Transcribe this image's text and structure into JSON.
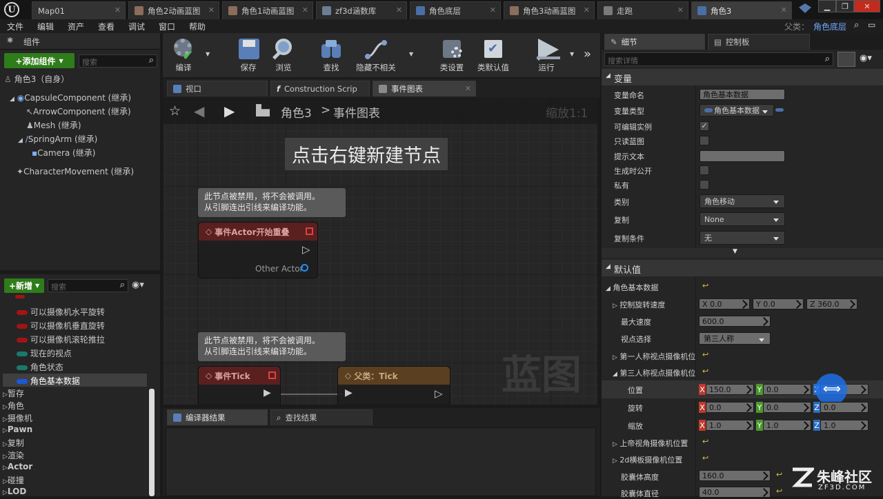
{
  "window": {
    "tabs": [
      {
        "label": "Map01"
      },
      {
        "label": "角色2动画蓝图"
      },
      {
        "label": "角色1动画蓝图"
      },
      {
        "label": "zf3d涵数库"
      },
      {
        "label": "角色底层"
      },
      {
        "label": "角色3动画蓝图"
      },
      {
        "label": "走跑"
      },
      {
        "label": "角色3"
      }
    ],
    "parent_label": "父类：",
    "parent_value": "角色底层"
  },
  "menu": [
    "文件",
    "编辑",
    "资产",
    "查看",
    "调试",
    "窗口",
    "帮助"
  ],
  "components": {
    "title": "组件",
    "add_button": "+添加组件",
    "search_placeholder": "搜索",
    "self": "角色3（自身）",
    "items": [
      "CapsuleComponent (继承)",
      "ArrowComponent (继承)",
      "Mesh (继承)",
      "SpringArm (继承)",
      "Camera (继承)",
      "CharacterMovement (继承)"
    ]
  },
  "mybp": {
    "add_button": "+新增",
    "search_placeholder": "搜索",
    "vars": [
      {
        "name": "可以摄像机水平旋转",
        "color": "#a31414"
      },
      {
        "name": "可以摄像机垂直旋转",
        "color": "#a31414"
      },
      {
        "name": "可以摄像机滚轮推拉",
        "color": "#a31414"
      },
      {
        "name": "现在的视点",
        "color": "#1a7a6a"
      },
      {
        "name": "角色状态",
        "color": "#1a7a6a"
      },
      {
        "name": "角色基本数据",
        "color": "#1a5ad9"
      }
    ],
    "cats": [
      "暂存",
      "角色",
      "摄像机",
      "Pawn",
      "复制",
      "渲染",
      "Actor",
      "碰撞",
      "LOD"
    ]
  },
  "toolbar": [
    "编译",
    "保存",
    "浏览",
    "查找",
    "隐藏不相关",
    "类设置",
    "类默认值",
    "运行"
  ],
  "graph": {
    "tabs": [
      "视口",
      "Construction Scrip",
      "事件图表"
    ],
    "crumb_root": "角色3",
    "crumb_sep": ">",
    "crumb_leaf": "事件图表",
    "zoom": "缩放1:1",
    "hint": "点击右键新建节点",
    "watermark": "蓝图",
    "comment1": [
      "此节点被禁用，将不会被调用。",
      "从引脚连出引线来编译功能。"
    ],
    "comment2": [
      "此节点被禁用，将不会被调用。",
      "从引脚连出引线来编译功能。"
    ],
    "node1_title": "事件Actor开始重叠",
    "node1_pin": "Other Actor",
    "node2_title": "事件Tick",
    "node3_title": "父类：Tick"
  },
  "bottom_tabs": [
    "编译器结果",
    "查找结果"
  ],
  "details": {
    "tab1": "细节",
    "tab2": "控制板",
    "search_placeholder": "搜索详情",
    "sect_var": "变量",
    "sect_default": "默认值",
    "var_rows": [
      {
        "label": "变量命名",
        "value": "角色基本数据"
      },
      {
        "label": "变量类型",
        "value": "角色基本数据"
      },
      {
        "label": "可编辑实例"
      },
      {
        "label": "只读蓝图"
      },
      {
        "label": "提示文本"
      },
      {
        "label": "生成时公开"
      },
      {
        "label": "私有"
      },
      {
        "label": "类别",
        "value": "角色移动"
      },
      {
        "label": "复制",
        "value": "None"
      },
      {
        "label": "复制条件",
        "value": "无"
      }
    ],
    "struct_label": "角色基本数据",
    "rot_label": "控制旋转速度",
    "rot": [
      "X  0.0",
      "Y  0.0",
      "Z  360.0"
    ],
    "maxspeed_label": "最大速度",
    "maxspeed": "600.0",
    "view_label": "视点选择",
    "view": "第三人称",
    "fp_label": "第一人称视点摄像机位",
    "tp_label": "第三人称视点摄像机位",
    "pos_label": "位置",
    "pos": [
      "150.0",
      "0.0",
      "0.0"
    ],
    "rotv_label": "旋转",
    "rotv": [
      "0.0",
      "0.0",
      "0.0"
    ],
    "scale_label": "缩放",
    "scale": [
      "1.0",
      "1.0",
      "1.0"
    ],
    "top_label": "上帝视角摄像机位置",
    "side_label": "2d横板摄像机位置",
    "cap_h_label": "胶囊体高度",
    "cap_h": "160.0",
    "cap_r_label": "胶囊体直径",
    "cap_r": "40.0"
  },
  "logo": {
    "cn": "朱峰社区",
    "en": "ZF3D.COM"
  }
}
